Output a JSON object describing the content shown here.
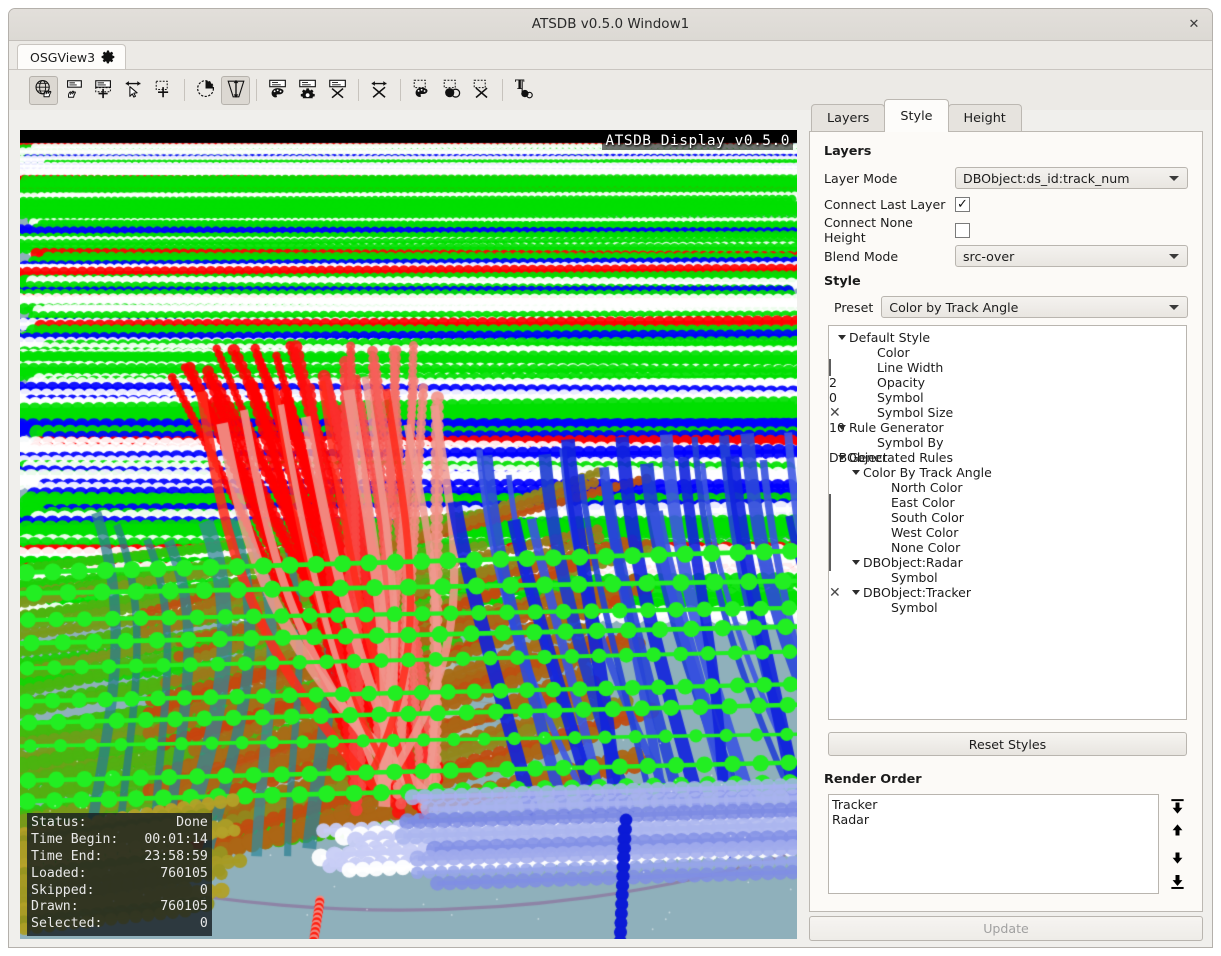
{
  "window": {
    "title": "ATSDB v0.5.0 Window1",
    "close_label": "✕"
  },
  "view_tab": {
    "label": "OSGView3",
    "config_icon": "gear-icon"
  },
  "toolbar": {
    "buttons": [
      {
        "name": "navigate-globe-button",
        "icon": "globe-hand-icon",
        "active": true
      },
      {
        "name": "select-layer-button",
        "icon": "layer-hand-icon",
        "active": false
      },
      {
        "name": "add-layer-button",
        "icon": "layer-plus-icon",
        "active": false
      },
      {
        "name": "select-cursor-button",
        "icon": "arrows-cursor-icon",
        "active": false
      },
      {
        "name": "add-selection-button",
        "icon": "dashed-plus-icon",
        "active": false
      },
      {
        "name": "time-filter-button",
        "icon": "clock-pie-icon",
        "active": false
      },
      {
        "name": "height-range-button",
        "icon": "height-arrow-icon",
        "active": true
      },
      {
        "name": "layer-style-button",
        "icon": "layer-palette-icon",
        "active": false
      },
      {
        "name": "layer-settings-button",
        "icon": "layer-gear-icon",
        "active": false
      },
      {
        "name": "layer-delete-button",
        "icon": "layer-x-icon",
        "active": false
      },
      {
        "name": "connect-delete-button",
        "icon": "arrows-x-icon",
        "active": false
      },
      {
        "name": "selection-style-button",
        "icon": "dashed-palette-icon",
        "active": false
      },
      {
        "name": "selection-merge-button",
        "icon": "circles-merge-icon",
        "active": false
      },
      {
        "name": "selection-delete-button",
        "icon": "dashed-x-icon",
        "active": false
      },
      {
        "name": "label-button",
        "icon": "text-label-icon",
        "active": false
      }
    ]
  },
  "viewport": {
    "hud_title": "ATSDB Display v0.5.0",
    "background_color": "#8fb0bb",
    "status": [
      {
        "key": "Status:",
        "value": "Done"
      },
      {
        "key": "Time Begin:",
        "value": "00:01:14"
      },
      {
        "key": "Time End:",
        "value": "23:58:59"
      },
      {
        "key": "Loaded:",
        "value": "760105"
      },
      {
        "key": "Skipped:",
        "value": "0"
      },
      {
        "key": "Drawn:",
        "value": "760105"
      },
      {
        "key": "Selected:",
        "value": "0"
      }
    ]
  },
  "panel": {
    "tabs": [
      {
        "label": "Layers",
        "selected": false
      },
      {
        "label": "Style",
        "selected": true
      },
      {
        "label": "Height",
        "selected": false
      }
    ],
    "layers_section": {
      "heading": "Layers",
      "layer_mode_label": "Layer Mode",
      "layer_mode_value": "DBObject:ds_id:track_num",
      "connect_last_layer_label": "Connect Last Layer",
      "connect_last_layer_checked": true,
      "connect_none_height_label": "Connect None Height",
      "connect_none_height_checked": false,
      "blend_mode_label": "Blend Mode",
      "blend_mode_value": "src-over"
    },
    "style_section": {
      "heading": "Style",
      "preset_label": "Preset",
      "preset_value": "Color by Track Angle",
      "tree": [
        {
          "depth": 0,
          "twisty": true,
          "name": "Default Style",
          "value": null,
          "type": "none"
        },
        {
          "depth": 2,
          "twisty": false,
          "name": "Color",
          "value": "#a0a0a0",
          "type": "swatch"
        },
        {
          "depth": 2,
          "twisty": false,
          "name": "Line Width",
          "value": "2",
          "type": "text"
        },
        {
          "depth": 2,
          "twisty": false,
          "name": "Opacity",
          "value": "0",
          "type": "text"
        },
        {
          "depth": 2,
          "twisty": false,
          "name": "Symbol",
          "value": "✕",
          "type": "cross"
        },
        {
          "depth": 2,
          "twisty": false,
          "name": "Symbol Size",
          "value": "10",
          "type": "text"
        },
        {
          "depth": 0,
          "twisty": true,
          "name": "Rule Generator",
          "value": null,
          "type": "none"
        },
        {
          "depth": 2,
          "twisty": false,
          "name": "Symbol By",
          "value": "DBObject",
          "type": "text"
        },
        {
          "depth": 0,
          "twisty": true,
          "name": "Generated Rules",
          "value": null,
          "type": "none"
        },
        {
          "depth": 1,
          "twisty": true,
          "name": "Color By Track Angle",
          "value": null,
          "type": "none"
        },
        {
          "depth": 3,
          "twisty": false,
          "name": "North Color",
          "value": "#ff0000",
          "type": "swatch"
        },
        {
          "depth": 3,
          "twisty": false,
          "name": "East Color",
          "value": "#00e000",
          "type": "swatch"
        },
        {
          "depth": 3,
          "twisty": false,
          "name": "South Color",
          "value": "#0000ff",
          "type": "swatch"
        },
        {
          "depth": 3,
          "twisty": false,
          "name": "West Color",
          "value": "#ffffff",
          "type": "swatch"
        },
        {
          "depth": 3,
          "twisty": false,
          "name": "None Color",
          "value": "#666666",
          "type": "swatch"
        },
        {
          "depth": 1,
          "twisty": true,
          "name": "DBObject:Radar",
          "value": null,
          "type": "none"
        },
        {
          "depth": 3,
          "twisty": false,
          "name": "Symbol",
          "value": "✕",
          "type": "cross"
        },
        {
          "depth": 1,
          "twisty": true,
          "name": "DBObject:Tracker",
          "value": null,
          "type": "none"
        },
        {
          "depth": 3,
          "twisty": false,
          "name": "Symbol",
          "value": "●",
          "type": "dot"
        }
      ],
      "reset_button_label": "Reset Styles"
    },
    "render_order": {
      "heading": "Render Order",
      "items": [
        "Tracker",
        "Radar"
      ],
      "buttons": [
        {
          "name": "move-to-top-button",
          "icon": "arrow-to-top-icon"
        },
        {
          "name": "move-up-button",
          "icon": "arrow-up-icon"
        },
        {
          "name": "move-down-button",
          "icon": "arrow-down-icon"
        },
        {
          "name": "move-to-bottom-button",
          "icon": "arrow-to-bottom-icon"
        }
      ]
    },
    "update_button_label": "Update"
  }
}
